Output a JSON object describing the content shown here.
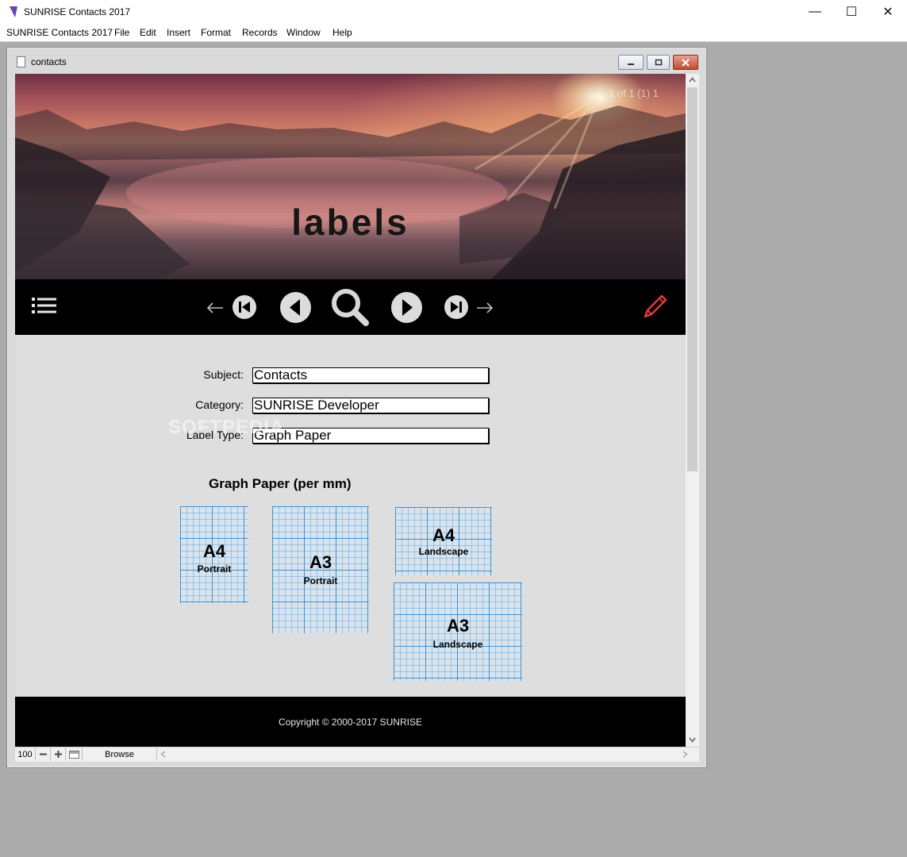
{
  "app": {
    "title": "SUNRISE Contacts 2017",
    "caption_buttons": {
      "minimize": "—",
      "maximize": "☐",
      "close": "✕"
    }
  },
  "menubar": {
    "items": [
      "SUNRISE Contacts 2017",
      "File",
      "Edit",
      "Insert",
      "Format",
      "Records",
      "Window",
      "Help"
    ]
  },
  "document": {
    "title": "contacts"
  },
  "banner": {
    "title": "labels",
    "record_counter": "1 of 1 (1) 1"
  },
  "navbar": {
    "icons": [
      "list-icon",
      "arrow-left-icon",
      "first-record-icon",
      "previous-record-icon",
      "search-icon",
      "next-record-icon",
      "last-record-icon",
      "arrow-right-icon",
      "edit-pencil-icon"
    ]
  },
  "form": {
    "subject_label": "Subject:",
    "subject_value": "Contacts",
    "category_label": "Category:",
    "category_value": "SUNRISE Developer",
    "label_type_label": "Label Type:",
    "label_type_value": "Graph Paper"
  },
  "graph_paper": {
    "heading": "Graph Paper (per mm)",
    "options": [
      {
        "size": "A4",
        "orientation": "Portrait"
      },
      {
        "size": "A3",
        "orientation": "Portrait"
      },
      {
        "size": "A4",
        "orientation": "Landscape"
      },
      {
        "size": "A3",
        "orientation": "Landscape"
      }
    ]
  },
  "watermark": "SOFTPEDIA",
  "footer": {
    "copyright": "Copyright © 2000-2017 SUNRISE"
  },
  "statusbar": {
    "zoom": "100",
    "mode": "Browse"
  },
  "colors": {
    "accent_pencil": "#e03a3a",
    "graph_line": "#3b93d9",
    "nav_background": "#000000"
  }
}
